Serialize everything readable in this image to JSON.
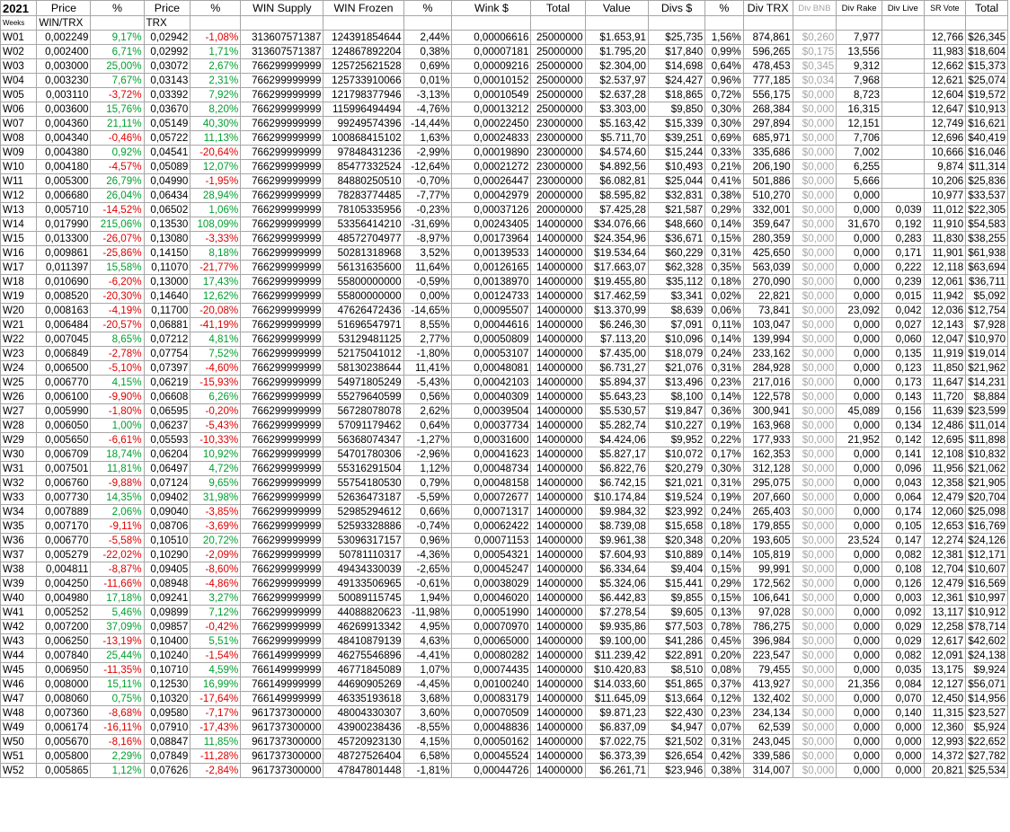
{
  "header_row1": [
    "2021",
    "Price",
    "%",
    "Price",
    "%",
    "WIN Supply",
    "WIN Frozen",
    "%",
    "Wink $",
    "Total",
    "Value",
    "Divs $",
    "%",
    "Div TRX",
    "Div BNB",
    "Div Rake",
    "Div Live",
    "SR Vote",
    "Total"
  ],
  "header_row2": [
    "Weeks",
    "WIN/TRX",
    "",
    "TRX",
    "",
    "",
    "",
    "",
    "",
    "",
    "",
    "",
    "",
    "",
    "",
    "",
    "",
    "",
    ""
  ],
  "rows": [
    [
      "W01",
      "0,002249",
      "9,17%",
      "0,02942",
      "-1,08%",
      "313607571387",
      "124391854644",
      "2,44%",
      "0,00006616",
      "25000000",
      "$1.653,91",
      "$25,735",
      "1,56%",
      "874,861",
      "$0,260",
      "7,977",
      "",
      "12,766",
      "$26,345"
    ],
    [
      "W02",
      "0,002400",
      "6,71%",
      "0,02992",
      "1,71%",
      "313607571387",
      "124867892204",
      "0,38%",
      "0,00007181",
      "25000000",
      "$1.795,20",
      "$17,840",
      "0,99%",
      "596,265",
      "$0,175",
      "13,556",
      "",
      "11,983",
      "$18,604"
    ],
    [
      "W03",
      "0,003000",
      "25,00%",
      "0,03072",
      "2,67%",
      "766299999999",
      "125725621528",
      "0,69%",
      "0,00009216",
      "25000000",
      "$2.304,00",
      "$14,698",
      "0,64%",
      "478,453",
      "$0,345",
      "9,312",
      "",
      "12,662",
      "$15,373"
    ],
    [
      "W04",
      "0,003230",
      "7,67%",
      "0,03143",
      "2,31%",
      "766299999999",
      "125733910066",
      "0,01%",
      "0,00010152",
      "25000000",
      "$2.537,97",
      "$24,427",
      "0,96%",
      "777,185",
      "$0,034",
      "7,968",
      "",
      "12,621",
      "$25,074"
    ],
    [
      "W05",
      "0,003110",
      "-3,72%",
      "0,03392",
      "7,92%",
      "766299999999",
      "121798377946",
      "-3,13%",
      "0,00010549",
      "25000000",
      "$2.637,28",
      "$18,865",
      "0,72%",
      "556,175",
      "$0,000",
      "8,723",
      "",
      "12,604",
      "$19,572"
    ],
    [
      "W06",
      "0,003600",
      "15,76%",
      "0,03670",
      "8,20%",
      "766299999999",
      "115996494494",
      "-4,76%",
      "0,00013212",
      "25000000",
      "$3.303,00",
      "$9,850",
      "0,30%",
      "268,384",
      "$0,000",
      "16,315",
      "",
      "12,647",
      "$10,913"
    ],
    [
      "W07",
      "0,004360",
      "21,11%",
      "0,05149",
      "40,30%",
      "766299999999",
      "99249574396",
      "-14,44%",
      "0,00022450",
      "23000000",
      "$5.163,42",
      "$15,339",
      "0,30%",
      "297,894",
      "$0,000",
      "12,151",
      "",
      "12,749",
      "$16,621"
    ],
    [
      "W08",
      "0,004340",
      "-0,46%",
      "0,05722",
      "11,13%",
      "766299999999",
      "100868415102",
      "1,63%",
      "0,00024833",
      "23000000",
      "$5.711,70",
      "$39,251",
      "0,69%",
      "685,971",
      "$0,000",
      "7,706",
      "",
      "12,696",
      "$40,419"
    ],
    [
      "W09",
      "0,004380",
      "0,92%",
      "0,04541",
      "-20,64%",
      "766299999999",
      "97848431236",
      "-2,99%",
      "0,00019890",
      "23000000",
      "$4.574,60",
      "$15,244",
      "0,33%",
      "335,686",
      "$0,000",
      "7,002",
      "",
      "10,666",
      "$16,046"
    ],
    [
      "W10",
      "0,004180",
      "-4,57%",
      "0,05089",
      "12,07%",
      "766299999999",
      "85477332524",
      "-12,64%",
      "0,00021272",
      "23000000",
      "$4.892,56",
      "$10,493",
      "0,21%",
      "206,190",
      "$0,000",
      "6,255",
      "",
      "9,874",
      "$11,314"
    ],
    [
      "W11",
      "0,005300",
      "26,79%",
      "0,04990",
      "-1,95%",
      "766299999999",
      "84880250510",
      "-0,70%",
      "0,00026447",
      "23000000",
      "$6.082,81",
      "$25,044",
      "0,41%",
      "501,886",
      "$0,000",
      "5,666",
      "",
      "10,206",
      "$25,836"
    ],
    [
      "W12",
      "0,006680",
      "26,04%",
      "0,06434",
      "28,94%",
      "766299999999",
      "78283774485",
      "-7,77%",
      "0,00042979",
      "20000000",
      "$8.595,82",
      "$32,831",
      "0,38%",
      "510,270",
      "$0,000",
      "0,000",
      "",
      "10,977",
      "$33,537"
    ],
    [
      "W13",
      "0,005710",
      "-14,52%",
      "0,06502",
      "1,06%",
      "766299999999",
      "78105335956",
      "-0,23%",
      "0,00037126",
      "20000000",
      "$7.425,28",
      "$21,587",
      "0,29%",
      "332,001",
      "$0,000",
      "0,000",
      "0,039",
      "11,012",
      "$22,305"
    ],
    [
      "W14",
      "0,017990",
      "215,06%",
      "0,13530",
      "108,09%",
      "766299999999",
      "53356414210",
      "-31,69%",
      "0,00243405",
      "14000000",
      "$34.076,66",
      "$48,660",
      "0,14%",
      "359,647",
      "$0,000",
      "31,670",
      "0,192",
      "11,910",
      "$54,583"
    ],
    [
      "W15",
      "0,013300",
      "-26,07%",
      "0,13080",
      "-3,33%",
      "766299999999",
      "48572704977",
      "-8,97%",
      "0,00173964",
      "14000000",
      "$24.354,96",
      "$36,671",
      "0,15%",
      "280,359",
      "$0,000",
      "0,000",
      "0,283",
      "11,830",
      "$38,255"
    ],
    [
      "W16",
      "0,009861",
      "-25,86%",
      "0,14150",
      "8,18%",
      "766299999999",
      "50281318968",
      "3,52%",
      "0,00139533",
      "14000000",
      "$19.534,64",
      "$60,229",
      "0,31%",
      "425,650",
      "$0,000",
      "0,000",
      "0,171",
      "11,901",
      "$61,938"
    ],
    [
      "W17",
      "0,011397",
      "15,58%",
      "0,11070",
      "-21,77%",
      "766299999999",
      "56131635600",
      "11,64%",
      "0,00126165",
      "14000000",
      "$17.663,07",
      "$62,328",
      "0,35%",
      "563,039",
      "$0,000",
      "0,000",
      "0,222",
      "12,118",
      "$63,694"
    ],
    [
      "W18",
      "0,010690",
      "-6,20%",
      "0,13000",
      "17,43%",
      "766299999999",
      "55800000000",
      "-0,59%",
      "0,00138970",
      "14000000",
      "$19.455,80",
      "$35,112",
      "0,18%",
      "270,090",
      "$0,000",
      "0,000",
      "0,239",
      "12,061",
      "$36,711"
    ],
    [
      "W19",
      "0,008520",
      "-20,30%",
      "0,14640",
      "12,62%",
      "766299999999",
      "55800000000",
      "0,00%",
      "0,00124733",
      "14000000",
      "$17.462,59",
      "$3,341",
      "0,02%",
      "22,821",
      "$0,000",
      "0,000",
      "0,015",
      "11,942",
      "$5,092"
    ],
    [
      "W20",
      "0,008163",
      "-4,19%",
      "0,11700",
      "-20,08%",
      "766299999999",
      "47626472436",
      "-14,65%",
      "0,00095507",
      "14000000",
      "$13.370,99",
      "$8,639",
      "0,06%",
      "73,841",
      "$0,000",
      "23,092",
      "0,042",
      "12,036",
      "$12,754"
    ],
    [
      "W21",
      "0,006484",
      "-20,57%",
      "0,06881",
      "-41,19%",
      "766299999999",
      "51696547971",
      "8,55%",
      "0,00044616",
      "14000000",
      "$6.246,30",
      "$7,091",
      "0,11%",
      "103,047",
      "$0,000",
      "0,000",
      "0,027",
      "12,143",
      "$7,928"
    ],
    [
      "W22",
      "0,007045",
      "8,65%",
      "0,07212",
      "4,81%",
      "766299999999",
      "53129481125",
      "2,77%",
      "0,00050809",
      "14000000",
      "$7.113,20",
      "$10,096",
      "0,14%",
      "139,994",
      "$0,000",
      "0,000",
      "0,060",
      "12,047",
      "$10,970"
    ],
    [
      "W23",
      "0,006849",
      "-2,78%",
      "0,07754",
      "7,52%",
      "766299999999",
      "52175041012",
      "-1,80%",
      "0,00053107",
      "14000000",
      "$7.435,00",
      "$18,079",
      "0,24%",
      "233,162",
      "$0,000",
      "0,000",
      "0,135",
      "11,919",
      "$19,014"
    ],
    [
      "W24",
      "0,006500",
      "-5,10%",
      "0,07397",
      "-4,60%",
      "766299999999",
      "58130238644",
      "11,41%",
      "0,00048081",
      "14000000",
      "$6.731,27",
      "$21,076",
      "0,31%",
      "284,928",
      "$0,000",
      "0,000",
      "0,123",
      "11,850",
      "$21,962"
    ],
    [
      "W25",
      "0,006770",
      "4,15%",
      "0,06219",
      "-15,93%",
      "766299999999",
      "54971805249",
      "-5,43%",
      "0,00042103",
      "14000000",
      "$5.894,37",
      "$13,496",
      "0,23%",
      "217,016",
      "$0,000",
      "0,000",
      "0,173",
      "11,647",
      "$14,231"
    ],
    [
      "W26",
      "0,006100",
      "-9,90%",
      "0,06608",
      "6,26%",
      "766299999999",
      "55279640599",
      "0,56%",
      "0,00040309",
      "14000000",
      "$5.643,23",
      "$8,100",
      "0,14%",
      "122,578",
      "$0,000",
      "0,000",
      "0,143",
      "11,720",
      "$8,884"
    ],
    [
      "W27",
      "0,005990",
      "-1,80%",
      "0,06595",
      "-0,20%",
      "766299999999",
      "56728078078",
      "2,62%",
      "0,00039504",
      "14000000",
      "$5.530,57",
      "$19,847",
      "0,36%",
      "300,941",
      "$0,000",
      "45,089",
      "0,156",
      "11,639",
      "$23,599"
    ],
    [
      "W28",
      "0,006050",
      "1,00%",
      "0,06237",
      "-5,43%",
      "766299999999",
      "57091179462",
      "0,64%",
      "0,00037734",
      "14000000",
      "$5.282,74",
      "$10,227",
      "0,19%",
      "163,968",
      "$0,000",
      "0,000",
      "0,134",
      "12,486",
      "$11,014"
    ],
    [
      "W29",
      "0,005650",
      "-6,61%",
      "0,05593",
      "-10,33%",
      "766299999999",
      "56368074347",
      "-1,27%",
      "0,00031600",
      "14000000",
      "$4.424,06",
      "$9,952",
      "0,22%",
      "177,933",
      "$0,000",
      "21,952",
      "0,142",
      "12,695",
      "$11,898"
    ],
    [
      "W30",
      "0,006709",
      "18,74%",
      "0,06204",
      "10,92%",
      "766299999999",
      "54701780306",
      "-2,96%",
      "0,00041623",
      "14000000",
      "$5.827,17",
      "$10,072",
      "0,17%",
      "162,353",
      "$0,000",
      "0,000",
      "0,141",
      "12,108",
      "$10,832"
    ],
    [
      "W31",
      "0,007501",
      "11,81%",
      "0,06497",
      "4,72%",
      "766299999999",
      "55316291504",
      "1,12%",
      "0,00048734",
      "14000000",
      "$6.822,76",
      "$20,279",
      "0,30%",
      "312,128",
      "$0,000",
      "0,000",
      "0,096",
      "11,956",
      "$21,062"
    ],
    [
      "W32",
      "0,006760",
      "-9,88%",
      "0,07124",
      "9,65%",
      "766299999999",
      "55754180530",
      "0,79%",
      "0,00048158",
      "14000000",
      "$6.742,15",
      "$21,021",
      "0,31%",
      "295,075",
      "$0,000",
      "0,000",
      "0,043",
      "12,358",
      "$21,905"
    ],
    [
      "W33",
      "0,007730",
      "14,35%",
      "0,09402",
      "31,98%",
      "766299999999",
      "52636473187",
      "-5,59%",
      "0,00072677",
      "14000000",
      "$10.174,84",
      "$19,524",
      "0,19%",
      "207,660",
      "$0,000",
      "0,000",
      "0,064",
      "12,479",
      "$20,704"
    ],
    [
      "W34",
      "0,007889",
      "2,06%",
      "0,09040",
      "-3,85%",
      "766299999999",
      "52985294612",
      "0,66%",
      "0,00071317",
      "14000000",
      "$9.984,32",
      "$23,992",
      "0,24%",
      "265,403",
      "$0,000",
      "0,000",
      "0,174",
      "12,060",
      "$25,098"
    ],
    [
      "W35",
      "0,007170",
      "-9,11%",
      "0,08706",
      "-3,69%",
      "766299999999",
      "52593328886",
      "-0,74%",
      "0,00062422",
      "14000000",
      "$8.739,08",
      "$15,658",
      "0,18%",
      "179,855",
      "$0,000",
      "0,000",
      "0,105",
      "12,653",
      "$16,769"
    ],
    [
      "W36",
      "0,006770",
      "-5,58%",
      "0,10510",
      "20,72%",
      "766299999999",
      "53096317157",
      "0,96%",
      "0,00071153",
      "14000000",
      "$9.961,38",
      "$20,348",
      "0,20%",
      "193,605",
      "$0,000",
      "23,524",
      "0,147",
      "12,274",
      "$24,126"
    ],
    [
      "W37",
      "0,005279",
      "-22,02%",
      "0,10290",
      "-2,09%",
      "766299999999",
      "50781110317",
      "-4,36%",
      "0,00054321",
      "14000000",
      "$7.604,93",
      "$10,889",
      "0,14%",
      "105,819",
      "$0,000",
      "0,000",
      "0,082",
      "12,381",
      "$12,171"
    ],
    [
      "W38",
      "0,004811",
      "-8,87%",
      "0,09405",
      "-8,60%",
      "766299999999",
      "49434330039",
      "-2,65%",
      "0,00045247",
      "14000000",
      "$6.334,64",
      "$9,404",
      "0,15%",
      "99,991",
      "$0,000",
      "0,000",
      "0,108",
      "12,704",
      "$10,607"
    ],
    [
      "W39",
      "0,004250",
      "-11,66%",
      "0,08948",
      "-4,86%",
      "766299999999",
      "49133506965",
      "-0,61%",
      "0,00038029",
      "14000000",
      "$5.324,06",
      "$15,441",
      "0,29%",
      "172,562",
      "$0,000",
      "0,000",
      "0,126",
      "12,479",
      "$16,569"
    ],
    [
      "W40",
      "0,004980",
      "17,18%",
      "0,09241",
      "3,27%",
      "766299999999",
      "50089115745",
      "1,94%",
      "0,00046020",
      "14000000",
      "$6.442,83",
      "$9,855",
      "0,15%",
      "106,641",
      "$0,000",
      "0,000",
      "0,003",
      "12,361",
      "$10,997"
    ],
    [
      "W41",
      "0,005252",
      "5,46%",
      "0,09899",
      "7,12%",
      "766299999999",
      "44088820623",
      "-11,98%",
      "0,00051990",
      "14000000",
      "$7.278,54",
      "$9,605",
      "0,13%",
      "97,028",
      "$0,000",
      "0,000",
      "0,092",
      "13,117",
      "$10,912"
    ],
    [
      "W42",
      "0,007200",
      "37,09%",
      "0,09857",
      "-0,42%",
      "766299999999",
      "46269913342",
      "4,95%",
      "0,00070970",
      "14000000",
      "$9.935,86",
      "$77,503",
      "0,78%",
      "786,275",
      "$0,000",
      "0,000",
      "0,029",
      "12,258",
      "$78,714"
    ],
    [
      "W43",
      "0,006250",
      "-13,19%",
      "0,10400",
      "5,51%",
      "766299999999",
      "48410879139",
      "4,63%",
      "0,00065000",
      "14000000",
      "$9.100,00",
      "$41,286",
      "0,45%",
      "396,984",
      "$0,000",
      "0,000",
      "0,029",
      "12,617",
      "$42,602"
    ],
    [
      "W44",
      "0,007840",
      "25,44%",
      "0,10240",
      "-1,54%",
      "766149999999",
      "46275546896",
      "-4,41%",
      "0,00080282",
      "14000000",
      "$11.239,42",
      "$22,891",
      "0,20%",
      "223,547",
      "$0,000",
      "0,000",
      "0,082",
      "12,091",
      "$24,138"
    ],
    [
      "W45",
      "0,006950",
      "-11,35%",
      "0,10710",
      "4,59%",
      "766149999999",
      "46771845089",
      "1,07%",
      "0,00074435",
      "14000000",
      "$10.420,83",
      "$8,510",
      "0,08%",
      "79,455",
      "$0,000",
      "0,000",
      "0,035",
      "13,175",
      "$9,924"
    ],
    [
      "W46",
      "0,008000",
      "15,11%",
      "0,12530",
      "16,99%",
      "766149999999",
      "44690905269",
      "-4,45%",
      "0,00100240",
      "14000000",
      "$14.033,60",
      "$51,865",
      "0,37%",
      "413,927",
      "$0,000",
      "21,356",
      "0,084",
      "12,127",
      "$56,071"
    ],
    [
      "W47",
      "0,008060",
      "0,75%",
      "0,10320",
      "-17,64%",
      "766149999999",
      "46335193618",
      "3,68%",
      "0,00083179",
      "14000000",
      "$11.645,09",
      "$13,664",
      "0,12%",
      "132,402",
      "$0,000",
      "0,000",
      "0,070",
      "12,450",
      "$14,956"
    ],
    [
      "W48",
      "0,007360",
      "-8,68%",
      "0,09580",
      "-7,17%",
      "961737300000",
      "48004330307",
      "3,60%",
      "0,00070509",
      "14000000",
      "$9.871,23",
      "$22,430",
      "0,23%",
      "234,134",
      "$0,000",
      "0,000",
      "0,140",
      "11,315",
      "$23,527"
    ],
    [
      "W49",
      "0,006174",
      "-16,11%",
      "0,07910",
      "-17,43%",
      "961737300000",
      "43900238436",
      "-8,55%",
      "0,00048836",
      "14000000",
      "$6.837,09",
      "$4,947",
      "0,07%",
      "62,539",
      "$0,000",
      "0,000",
      "0,000",
      "12,360",
      "$5,924"
    ],
    [
      "W50",
      "0,005670",
      "-8,16%",
      "0,08847",
      "11,85%",
      "961737300000",
      "45720923130",
      "4,15%",
      "0,00050162",
      "14000000",
      "$7.022,75",
      "$21,502",
      "0,31%",
      "243,045",
      "$0,000",
      "0,000",
      "0,000",
      "12,993",
      "$22,652"
    ],
    [
      "W51",
      "0,005800",
      "2,29%",
      "0,07849",
      "-11,28%",
      "961737300000",
      "48727526404",
      "6,58%",
      "0,00045524",
      "14000000",
      "$6.373,39",
      "$26,654",
      "0,42%",
      "339,586",
      "$0,000",
      "0,000",
      "0,000",
      "14,372",
      "$27,782"
    ],
    [
      "W52",
      "0,005865",
      "1,12%",
      "0,07626",
      "-2,84%",
      "961737300000",
      "47847801448",
      "-1,81%",
      "0,00044726",
      "14000000",
      "$6.261,71",
      "$23,946",
      "0,38%",
      "314,007",
      "$0,000",
      "0,000",
      "0,000",
      "20,821",
      "$25,534"
    ]
  ],
  "colors": {
    "positive": "#00a02e",
    "negative": "#e00000",
    "muted": "#a6a6a6",
    "grid": "#a6a6a6"
  }
}
